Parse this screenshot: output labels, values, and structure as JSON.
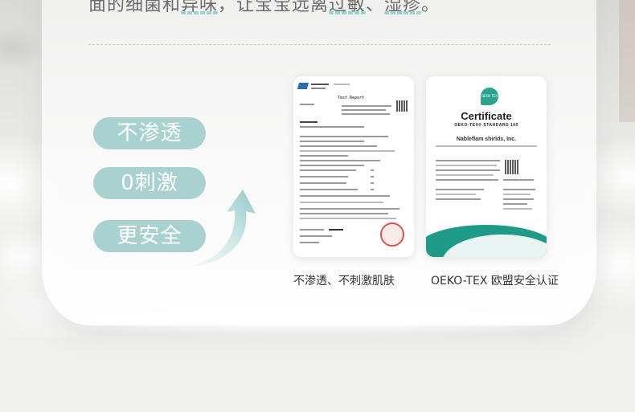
{
  "headline": {
    "part1": "面的细菌和",
    "part2": "异味",
    "part3": "，让宝宝远离",
    "part4": "过敏",
    "part5": "、",
    "part6": "湿疹",
    "part7": "。"
  },
  "features": [
    {
      "label": "不渗透"
    },
    {
      "label": "0刺激"
    },
    {
      "label": "更安全"
    }
  ],
  "documents": [
    {
      "caption": "不渗透、不刺激肌肤",
      "header": "Test Report"
    },
    {
      "caption": "OEKO-TEX 欧盟安全认证",
      "logo": "OEKO TEX",
      "title": "Certificate",
      "subtitle": "OEKO-TEX® STANDARD 100",
      "company": "Nableflam shirlds, Inc."
    }
  ],
  "colors": {
    "pill": "#a8d1d0",
    "accent": "#9fd3d3",
    "cert_green": "#1f9a88",
    "stamp_red": "#d9534f"
  }
}
